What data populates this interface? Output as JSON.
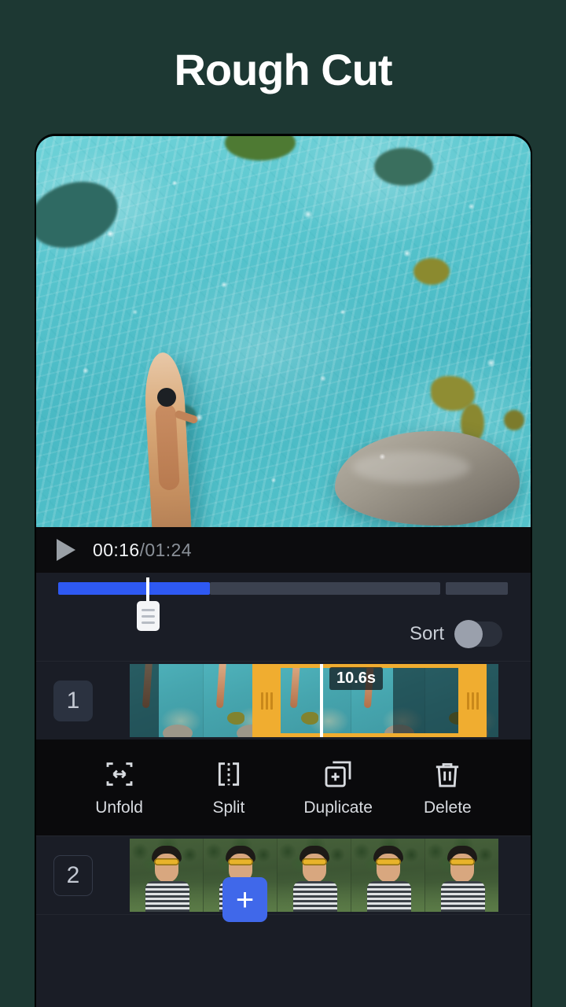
{
  "page": {
    "title": "Rough Cut",
    "background_color": "#1d3833"
  },
  "player": {
    "play_icon": "play-triangle-icon",
    "current_time": "00:16",
    "total_time": "/01:24",
    "progress_percent": 34,
    "accent_color": "#2e59f2",
    "playhead_icon": "drag-handle-icon"
  },
  "sort": {
    "label": "Sort",
    "enabled": false
  },
  "timeline": {
    "tracks": [
      {
        "number": "1",
        "badge_style": "filled",
        "selected": true,
        "duration_badge": "10.6s",
        "handle_color": "#f0ad30",
        "frames": [
          "water",
          "water",
          "water",
          "water",
          "water"
        ]
      },
      {
        "number": "2",
        "badge_style": "outlined",
        "selected": false,
        "frames": [
          "guy",
          "guy",
          "guy",
          "guy",
          "guy"
        ]
      }
    ],
    "add_button": {
      "label": "+",
      "name": "add-clip-button",
      "color": "#4068ea"
    }
  },
  "toolbar": {
    "items": [
      {
        "label": "Unfold",
        "icon": "unfold-arrows-icon"
      },
      {
        "label": "Split",
        "icon": "split-dashed-icon"
      },
      {
        "label": "Duplicate",
        "icon": "duplicate-plus-icon"
      },
      {
        "label": "Delete",
        "icon": "trash-icon"
      }
    ]
  }
}
